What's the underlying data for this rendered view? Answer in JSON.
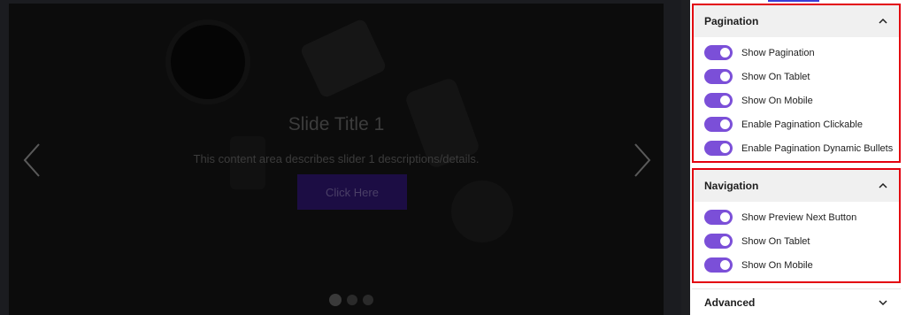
{
  "preview": {
    "slide_title": "Slide Title 1",
    "slide_description": "This content area describes slider 1 descriptions/details.",
    "slide_button_label": "Click Here",
    "dots_count": 3,
    "active_dot": 0
  },
  "pagination": {
    "title": "Pagination",
    "expanded": true,
    "toggles": [
      {
        "label": "Show Pagination",
        "on": true
      },
      {
        "label": "Show On Tablet",
        "on": true
      },
      {
        "label": "Show On Mobile",
        "on": true
      },
      {
        "label": "Enable Pagination Clickable",
        "on": true
      },
      {
        "label": "Enable Pagination Dynamic Bullets",
        "on": true
      }
    ]
  },
  "navigation": {
    "title": "Navigation",
    "expanded": true,
    "toggles": [
      {
        "label": "Show Preview Next Button",
        "on": true
      },
      {
        "label": "Show On Tablet",
        "on": true
      },
      {
        "label": "Show On Mobile",
        "on": true
      }
    ]
  },
  "advanced": {
    "title": "Advanced",
    "expanded": false
  },
  "colors": {
    "toggle_on": "#7b4fd8",
    "highlight_border": "#e3000f",
    "accent_tab": "#3b3bd6"
  }
}
